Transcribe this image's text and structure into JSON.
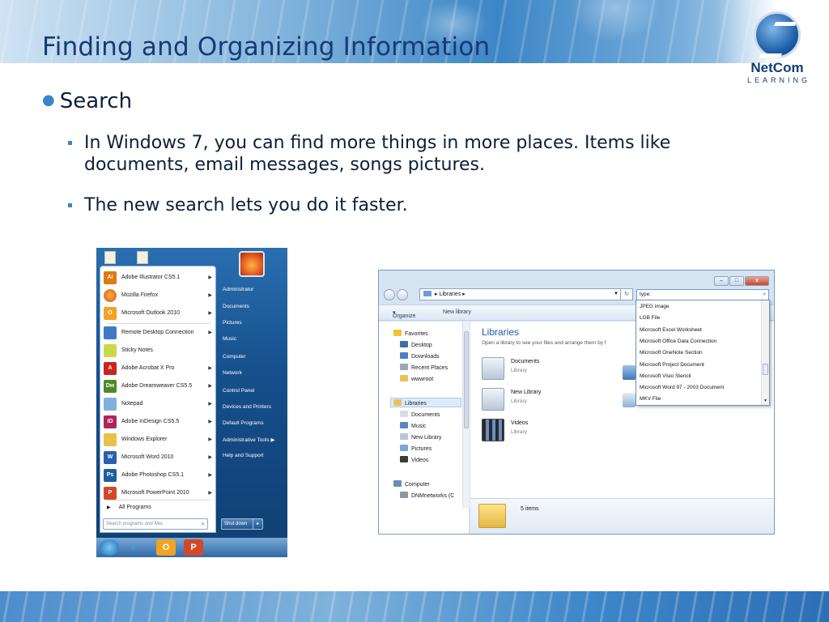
{
  "slide": {
    "title": "Finding and Organizing Information",
    "logo": {
      "brand": "NetCom",
      "sub": "LEARNING"
    },
    "bullet": "Search",
    "sub_bullets": [
      "In Windows 7, you can find more things in more places. Items like documents, email messages, songs pictures.",
      "The new search lets you do it faster."
    ]
  },
  "start_menu": {
    "programs": [
      {
        "label": "Adobe Illustrator CS5.1",
        "icon": "illustrator-icon",
        "badge": "Ai",
        "color": "#e07a14"
      },
      {
        "label": "Mozilla Firefox",
        "icon": "firefox-icon",
        "badge": "",
        "color": "#d9531e"
      },
      {
        "label": "Microsoft Outlook 2010",
        "icon": "outlook-icon",
        "badge": "O",
        "color": "#f2a325"
      },
      {
        "label": "Remote Desktop Connection",
        "icon": "remote-desktop-icon",
        "badge": "",
        "color": "#3d7cc4"
      },
      {
        "label": "Sticky Notes",
        "icon": "sticky-notes-icon",
        "badge": "",
        "color": "#c9d94a"
      },
      {
        "label": "Adobe Acrobat X Pro",
        "icon": "acrobat-icon",
        "badge": "A",
        "color": "#c7261e"
      },
      {
        "label": "Adobe Dreamweaver CS5.5",
        "icon": "dreamweaver-icon",
        "badge": "Dw",
        "color": "#4f8a25"
      },
      {
        "label": "Notepad",
        "icon": "notepad-icon",
        "badge": "",
        "color": "#7fb1de"
      },
      {
        "label": "Adobe InDesign CS5.5",
        "icon": "indesign-icon",
        "badge": "ID",
        "color": "#b0235f"
      },
      {
        "label": "Windows Explorer",
        "icon": "windows-explorer-icon",
        "badge": "",
        "color": "#e9c04a"
      },
      {
        "label": "Microsoft Word 2010",
        "icon": "word-icon",
        "badge": "W",
        "color": "#2b5fb0"
      },
      {
        "label": "Adobe Photoshop CS5.1",
        "icon": "photoshop-icon",
        "badge": "Ps",
        "color": "#1e5e9f"
      },
      {
        "label": "Microsoft PowerPoint 2010",
        "icon": "powerpoint-icon",
        "badge": "P",
        "color": "#d2492a"
      }
    ],
    "all_programs": "All Programs",
    "search_placeholder": "Search programs and files",
    "right_items": [
      "Administrator",
      "Documents",
      "Pictures",
      "Music",
      "Computer",
      "Network",
      "Control Panel",
      "Devices and Printers",
      "Default Programs",
      "Administrative Tools",
      "Help and Support"
    ],
    "shutdown": "Shut down"
  },
  "explorer": {
    "address": "Libraries",
    "search_value": "type:",
    "toolbar": {
      "organize": "Organize",
      "new_library": "New library"
    },
    "nav": {
      "favorites": "Favorites",
      "desktop": "Desktop",
      "downloads": "Downloads",
      "recent": "Recent Places",
      "wwwroot": "wwwroot",
      "libraries": "Libraries",
      "documents": "Documents",
      "music": "Music",
      "new_library": "New Library",
      "pictures": "Pictures",
      "videos": "Videos",
      "computer": "Computer",
      "dnm": "DNMnetworks (C"
    },
    "content": {
      "title": "Libraries",
      "subtitle": "Open a library to see your files and arrange them by f",
      "items": [
        {
          "name": "Documents",
          "type": "Library"
        },
        {
          "name": "New Library",
          "type": "Library"
        },
        {
          "name": "Videos",
          "type": "Library"
        }
      ]
    },
    "details": {
      "count": "5 items"
    },
    "dropdown": [
      "JPEG image",
      "LGB File",
      "Microsoft Excel Worksheet",
      "Microsoft Office Data Connection",
      "Microsoft OneNote Section",
      "Microsoft Project Document",
      "Microsoft Visio Stencil",
      "Microsoft Word 97 - 2003 Document",
      "MKV File"
    ]
  }
}
